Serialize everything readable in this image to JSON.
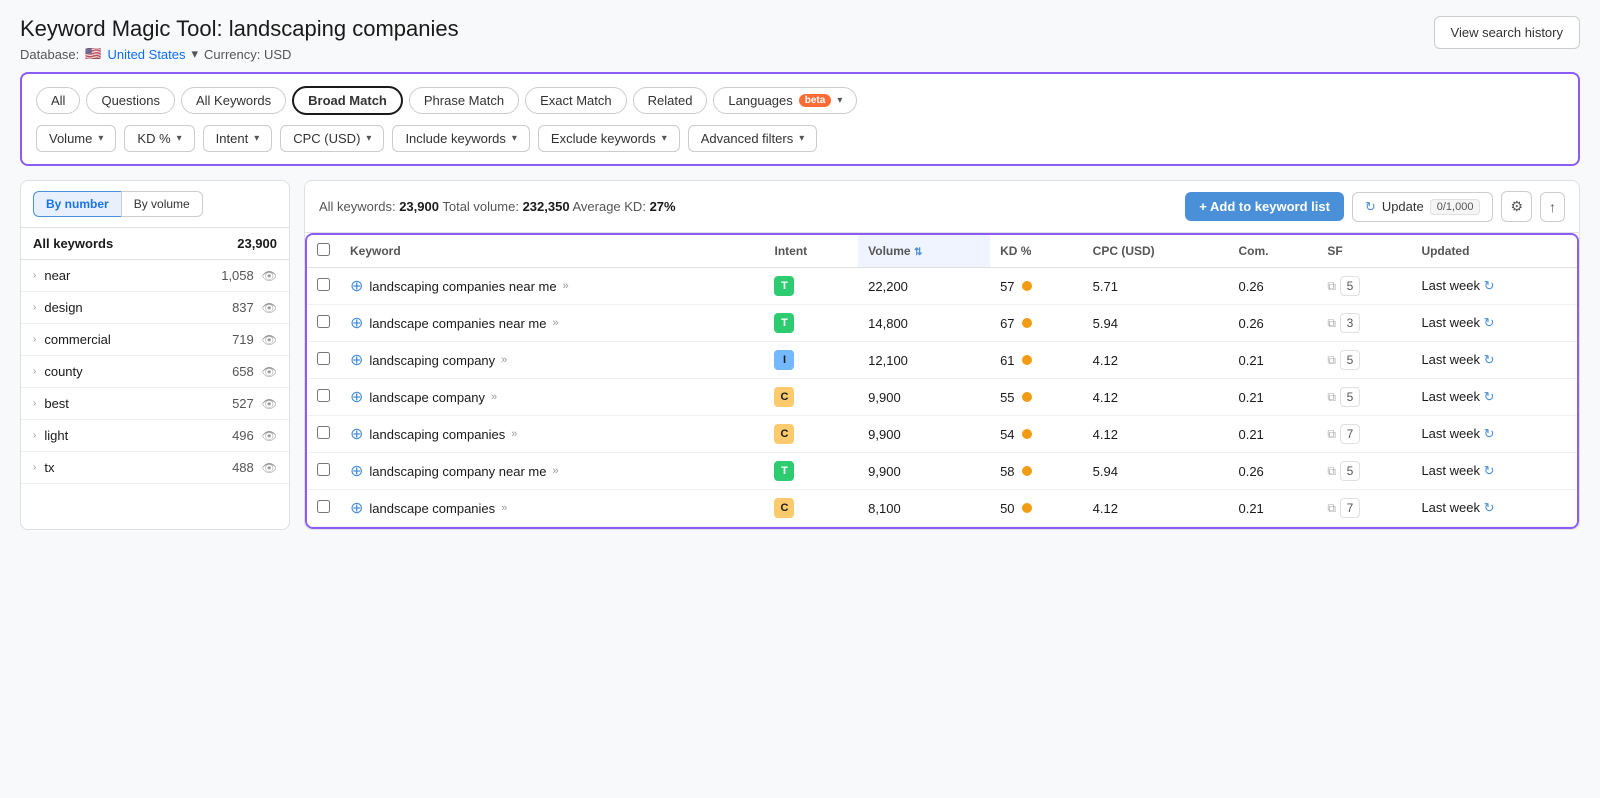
{
  "header": {
    "tool_label": "Keyword Magic Tool:",
    "query": "landscaping companies",
    "subtitle_database": "Database:",
    "flag": "🇺🇸",
    "country": "United States",
    "currency_label": "Currency: USD",
    "view_history_btn": "View search history"
  },
  "filter_tabs": {
    "tabs": [
      {
        "id": "all",
        "label": "All",
        "active": true
      },
      {
        "id": "questions",
        "label": "Questions",
        "active": false
      },
      {
        "id": "all-keywords",
        "label": "All Keywords",
        "active": false
      },
      {
        "id": "broad-match",
        "label": "Broad Match",
        "active": true,
        "selected": true
      },
      {
        "id": "phrase-match",
        "label": "Phrase Match",
        "active": false
      },
      {
        "id": "exact-match",
        "label": "Exact Match",
        "active": false
      },
      {
        "id": "related",
        "label": "Related",
        "active": false
      }
    ],
    "languages_btn": "Languages",
    "beta_badge": "beta",
    "dropdowns": [
      {
        "label": "Volume"
      },
      {
        "label": "KD %"
      },
      {
        "label": "Intent"
      },
      {
        "label": "CPC (USD)"
      },
      {
        "label": "Include keywords"
      },
      {
        "label": "Exclude keywords"
      },
      {
        "label": "Advanced filters"
      }
    ]
  },
  "sidebar": {
    "sort_by_number": "By number",
    "sort_by_volume": "By volume",
    "header_col1": "All keywords",
    "header_col2": "23,900",
    "items": [
      {
        "keyword": "near",
        "count": "1,058"
      },
      {
        "keyword": "design",
        "count": "837"
      },
      {
        "keyword": "commercial",
        "count": "719"
      },
      {
        "keyword": "county",
        "count": "658"
      },
      {
        "keyword": "best",
        "count": "527"
      },
      {
        "keyword": "light",
        "count": "496"
      },
      {
        "keyword": "tx",
        "count": "488"
      }
    ]
  },
  "table_bar": {
    "all_keywords_label": "All keywords:",
    "all_keywords_value": "23,900",
    "total_volume_label": "Total volume:",
    "total_volume_value": "232,350",
    "avg_kd_label": "Average KD:",
    "avg_kd_value": "27%",
    "add_btn": "+ Add to keyword list",
    "update_btn": "Update",
    "update_count": "0/1,000"
  },
  "table": {
    "columns": [
      {
        "id": "keyword",
        "label": "Keyword"
      },
      {
        "id": "intent",
        "label": "Intent"
      },
      {
        "id": "volume",
        "label": "Volume",
        "sorted": true
      },
      {
        "id": "kd",
        "label": "KD %"
      },
      {
        "id": "cpc",
        "label": "CPC (USD)"
      },
      {
        "id": "com",
        "label": "Com."
      },
      {
        "id": "sf",
        "label": "SF"
      },
      {
        "id": "updated",
        "label": "Updated"
      }
    ],
    "rows": [
      {
        "keyword": "landscaping companies near me",
        "intent": "T",
        "intent_type": "t",
        "volume": "22,200",
        "kd": "57",
        "cpc": "5.71",
        "com": "0.26",
        "sf": "5",
        "updated": "Last week"
      },
      {
        "keyword": "landscape companies near me",
        "intent": "T",
        "intent_type": "t",
        "volume": "14,800",
        "kd": "67",
        "cpc": "5.94",
        "com": "0.26",
        "sf": "3",
        "updated": "Last week"
      },
      {
        "keyword": "landscaping company",
        "intent": "I",
        "intent_type": "i",
        "volume": "12,100",
        "kd": "61",
        "cpc": "4.12",
        "com": "0.21",
        "sf": "5",
        "updated": "Last week"
      },
      {
        "keyword": "landscape company",
        "intent": "C",
        "intent_type": "c",
        "volume": "9,900",
        "kd": "55",
        "cpc": "4.12",
        "com": "0.21",
        "sf": "5",
        "updated": "Last week"
      },
      {
        "keyword": "landscaping companies",
        "intent": "C",
        "intent_type": "c",
        "volume": "9,900",
        "kd": "54",
        "cpc": "4.12",
        "com": "0.21",
        "sf": "7",
        "updated": "Last week"
      },
      {
        "keyword": "landscaping company near me",
        "intent": "T",
        "intent_type": "t",
        "volume": "9,900",
        "kd": "58",
        "cpc": "5.94",
        "com": "0.26",
        "sf": "5",
        "updated": "Last week"
      },
      {
        "keyword": "landscape companies",
        "intent": "C",
        "intent_type": "c",
        "volume": "8,100",
        "kd": "50",
        "cpc": "4.12",
        "com": "0.21",
        "sf": "7",
        "updated": "Last week"
      }
    ]
  }
}
